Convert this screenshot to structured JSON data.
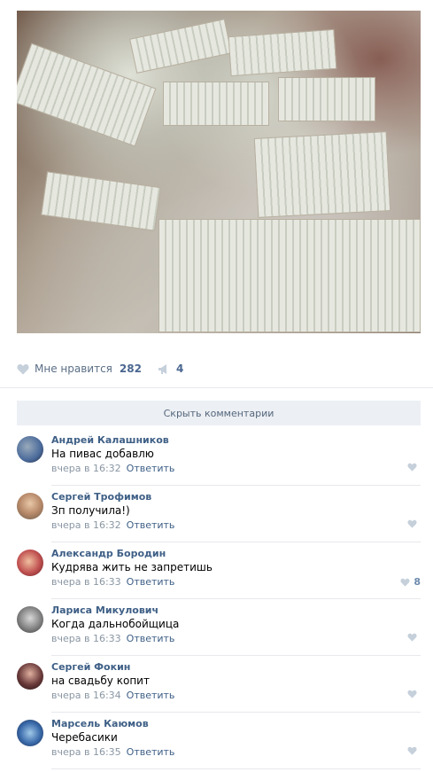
{
  "post": {
    "likes_label": "Мне нравится",
    "likes_count": "282",
    "shares_count": "4"
  },
  "comments_toggle": "Скрыть комментарии",
  "comments": [
    {
      "author": "Андрей Калашников",
      "text": "На пивас добавлю",
      "time": "вчера в 16:32",
      "reply": "Ответить",
      "likes": "",
      "avatar_color": "#4a6a9a"
    },
    {
      "author": "Сергей Трофимов",
      "text": "Зп получила!)",
      "time": "вчера в 16:32",
      "reply": "Ответить",
      "likes": "",
      "avatar_color": "#b88a6a"
    },
    {
      "author": "Александр Бородин",
      "text": "Кудрява жить не запретишь",
      "time": "вчера в 16:33",
      "reply": "Ответить",
      "likes": "8",
      "avatar_color": "#c05050"
    },
    {
      "author": "Лариса Микулович",
      "text": "Когда дальнобойщица",
      "time": "вчера в 16:33",
      "reply": "Ответить",
      "likes": "",
      "avatar_color": "#5a5a5a"
    },
    {
      "author": "Сергей Фокин",
      "text": "на свадьбу копит",
      "time": "вчера в 16:34",
      "reply": "Ответить",
      "likes": "",
      "avatar_color": "#6a3a3a"
    },
    {
      "author": "Марсель Каюмов",
      "text": "Черебасики",
      "time": "вчера в 16:35",
      "reply": "Ответить",
      "likes": "",
      "avatar_color": "#3a6aaa"
    }
  ],
  "colors": {
    "link": "#3e5f86",
    "meta": "#8a96a3",
    "heart": "#c5d0db"
  }
}
